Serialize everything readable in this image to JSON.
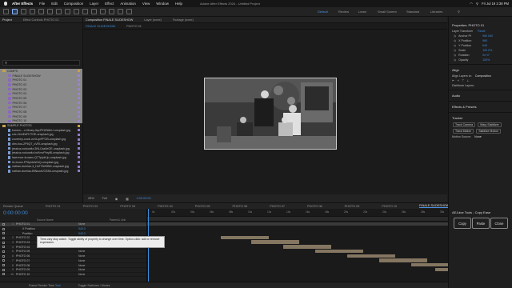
{
  "menubar": {
    "app_name": "After Effects",
    "items": [
      "File",
      "Edit",
      "Composition",
      "Layer",
      "Effect",
      "Animation",
      "View",
      "Window",
      "Help"
    ],
    "window_title": "Adobe After Effects 2024 - Untitled Project",
    "datetime": "Fri Jul 19  2:38 PM"
  },
  "workspaces": [
    "Default",
    "Review",
    "Learn",
    "Small Screen",
    "Standard",
    "Libraries"
  ],
  "project_panel": {
    "tabs": [
      "Project",
      "Effect Controls PHOTO 01"
    ],
    "search_placeholder": "",
    "items": [
      {
        "name": "COMPS",
        "type": "folder",
        "selected": true
      },
      {
        "name": "FINALE SLIDESHOW",
        "type": "comp",
        "selected": true
      },
      {
        "name": "PHOTO 01",
        "type": "comp",
        "selected": true
      },
      {
        "name": "PHOTO 02",
        "type": "comp",
        "selected": true
      },
      {
        "name": "PHOTO 03",
        "type": "comp",
        "selected": true
      },
      {
        "name": "PHOTO 04",
        "type": "comp",
        "selected": true
      },
      {
        "name": "PHOTO 05",
        "type": "comp",
        "selected": true
      },
      {
        "name": "PHOTO 06",
        "type": "comp",
        "selected": true
      },
      {
        "name": "PHOTO 07",
        "type": "comp",
        "selected": true
      },
      {
        "name": "PHOTO 08",
        "type": "comp",
        "selected": true
      },
      {
        "name": "PHOTO 09",
        "type": "comp",
        "selected": true
      },
      {
        "name": "PHOTO 10",
        "type": "comp",
        "selected": true
      },
      {
        "name": "SAMPLE PHOTOS",
        "type": "folder",
        "selected": false
      },
      {
        "name": "boston-...n-library-6qcPEi2N8eU-unsplash.jpg",
        "type": "file",
        "selected": false
      },
      {
        "name": "cdc-2lmrEdFHTOE-unsplash.jpg",
        "type": "file",
        "selected": false
      },
      {
        "name": "courtney-cook-uvXLqnPFOB-unsplash.jpg",
        "type": "file",
        "selected": false
      },
      {
        "name": "dim-hou-2P6Q7_uVEI-unsplash.jpg",
        "type": "file",
        "selected": false
      },
      {
        "name": "jessica-rockowitz-5NLCaz6eOE-unsplash.jpg",
        "type": "file",
        "selected": false
      },
      {
        "name": "jessica-rockowitz-bcKmvPbryBI-unsplash.jpg",
        "type": "file",
        "selected": false
      },
      {
        "name": "lawrence-krowec-Q7Tplyb1jo-unsplash.jpg",
        "type": "file",
        "selected": false
      },
      {
        "name": "liv-bruce-FF6pidwW4Q-unsplash.jpg",
        "type": "file",
        "selected": false
      },
      {
        "name": "nathan-dumlao-4_HoTSWKBM-unsplash.jpg",
        "type": "file",
        "selected": false
      },
      {
        "name": "nathan-dumlao-BtNuoaVCE8A-unsplash.jpg",
        "type": "file",
        "selected": false
      }
    ]
  },
  "viewer": {
    "tabs": [
      "Composition FINALE SLIDESHOW",
      "Layer (none)",
      "Footage (none)"
    ],
    "sub_tabs": [
      "FINALE SLIDESHOW",
      "PHOTO 01"
    ],
    "zoom": "25%",
    "resolution": "Full",
    "timecode": "0:00:00:00"
  },
  "properties": {
    "title": "Properties: PHOTO 01",
    "section": "Layer Transform",
    "reset": "Reset",
    "rows": [
      {
        "label": "Anchor Pt",
        "value": "960   540"
      },
      {
        "label": "X Position",
        "value": "960"
      },
      {
        "label": "Y Position",
        "value": "540"
      },
      {
        "label": "Scale",
        "value": "100.0%"
      },
      {
        "label": "Rotation",
        "value": "0x+0°"
      },
      {
        "label": "Opacity",
        "value": "100%"
      }
    ],
    "align_title": "Align",
    "align_to_label": "Align Layers to:",
    "align_to_value": "Composition",
    "distribute": "Distribute Layers:",
    "audio": "Audio",
    "effects": "Effects & Presets",
    "tracker_title": "Tracker",
    "tracker_buttons": [
      "Track Camera",
      "Warp Stabilizer",
      "Track Motion",
      "Stabilize Motion"
    ],
    "motion_source_label": "Motion Source:",
    "motion_source_value": "None"
  },
  "aetools": {
    "title": "AEJuice Tools - Copy Ease",
    "buttons": [
      "Copy",
      "Paste",
      "Clone"
    ]
  },
  "timeline": {
    "tabs": [
      "Render Queue",
      "PHOTO 01",
      "PHOTO 02",
      "PHOTO 03",
      "PHOTO 04",
      "PHOTO 05",
      "PHOTO 06",
      "PHOTO 07",
      "PHOTO 08",
      "PHOTO 09",
      "PHOTO 10",
      "FINALE SLIDESHOW"
    ],
    "active_tab": "FINALE SLIDESHOW",
    "timecode": "0:00:00:00",
    "source_name_header": "Source Name",
    "parent_header": "Parent & Link",
    "ruler_ticks": [
      "0s",
      "02s",
      "04s",
      "06s",
      "08s",
      "10s",
      "12s",
      "14s",
      "16s",
      "18s",
      "20s",
      "22s",
      "24s",
      "26s",
      "28s",
      "30s"
    ],
    "layers": [
      {
        "num": "1",
        "name": "PHOTO 01",
        "mode": "None",
        "sub": false
      },
      {
        "num": "",
        "name": "X Position",
        "mode": "540.0",
        "sub": true
      },
      {
        "num": "",
        "name": "Position",
        "mode": "540.0",
        "sub": true
      },
      {
        "num": "2",
        "name": "PHOTO 02",
        "mode": "None",
        "sub": false
      },
      {
        "num": "3",
        "name": "PHOTO 03",
        "mode": "None",
        "sub": false
      },
      {
        "num": "4",
        "name": "PHOTO 04",
        "mode": "None",
        "sub": false
      },
      {
        "num": "5",
        "name": "PHOTO 05",
        "mode": "None",
        "sub": false
      },
      {
        "num": "6",
        "name": "PHOTO 06",
        "mode": "None",
        "sub": false
      },
      {
        "num": "7",
        "name": "PHOTO 07",
        "mode": "None",
        "sub": false
      },
      {
        "num": "8",
        "name": "PHOTO 08",
        "mode": "None",
        "sub": false
      },
      {
        "num": "9",
        "name": "PHOTO 09",
        "mode": "None",
        "sub": false
      },
      {
        "num": "10",
        "name": "PHOTO 10",
        "mode": "None",
        "sub": false
      }
    ],
    "tooltip": "Time-vary stop watch. Toggle ability of property to change over time. Option-click: add or remove expression.",
    "frame_render_label": "Frame Render Time",
    "frame_render_value": "3ms",
    "toggle_label": "Toggle Switches / Modes"
  }
}
